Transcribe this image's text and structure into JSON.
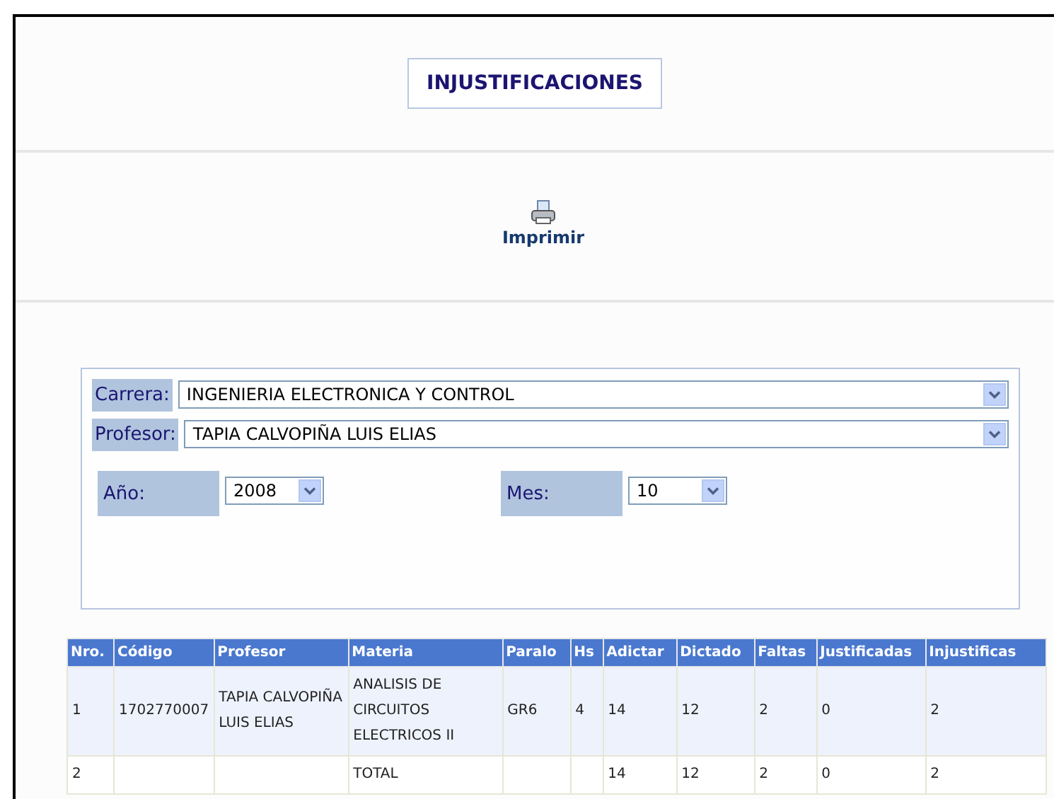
{
  "title": "INJUSTIFICACIONES",
  "print_button": {
    "label": "Imprimir"
  },
  "filters": {
    "wide": [
      {
        "label": "Carrera:",
        "value": "INGENIERIA ELECTRONICA Y CONTROL"
      },
      {
        "label": "Profesor:",
        "value": "TAPIA CALVOPIÑA LUIS ELIAS"
      }
    ],
    "narrow": [
      {
        "label": "Año:",
        "value": "2008"
      },
      {
        "label": "Mes:",
        "value": "10"
      }
    ]
  },
  "table": {
    "columns": [
      "Nro.",
      "Código",
      "Profesor",
      "Materia",
      "Paralo",
      "Hs",
      "Adictar",
      "Dictado",
      "Faltas",
      "Justificadas",
      "Injustificas"
    ],
    "rows": [
      [
        "1",
        "1702770007",
        "TAPIA CALVOPIÑA LUIS ELIAS",
        "ANALISIS DE CIRCUITOS ELECTRICOS II",
        "GR6",
        "4",
        "14",
        "12",
        "2",
        "0",
        "2"
      ],
      [
        "2",
        "",
        "",
        "TOTAL",
        "",
        "",
        "14",
        "12",
        "2",
        "0",
        "2"
      ]
    ]
  }
}
